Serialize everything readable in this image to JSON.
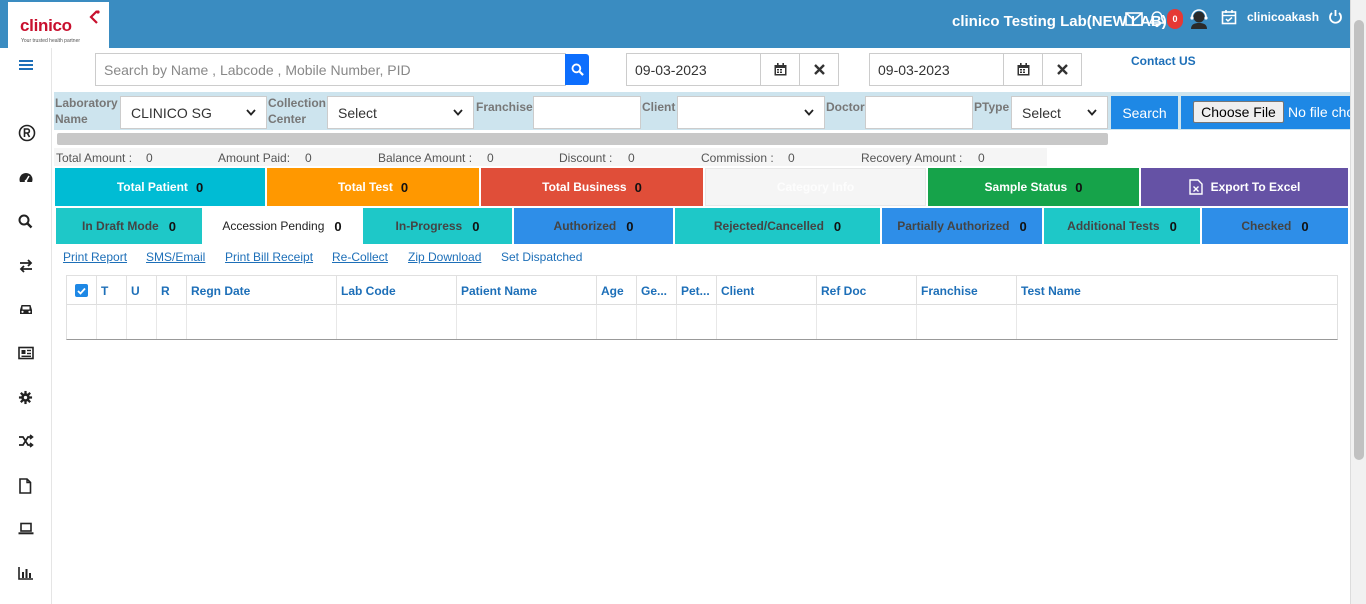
{
  "header": {
    "brand": "clinico",
    "tagline": "Your trusted health partner",
    "lab_title": "clinico Testing Lab(NEW LAB)",
    "notification_count": "0",
    "username": "clinicoakash",
    "background_color": "#3a8cc1"
  },
  "search": {
    "placeholder": "Search by Name , Labcode , Mobile Number, PID",
    "from_date": "09-03-2023",
    "to_date": "09-03-2023",
    "contact_label": "Contact US"
  },
  "filters": {
    "lab_label": "Laboratory Name",
    "lab_value": "CLINICO SG",
    "cc_label": "Collection Center",
    "cc_value": "Select",
    "franchise_label": "Franchise",
    "client_label": "Client",
    "doctor_label": "Doctor",
    "ptype_label": "PType",
    "ptype_value": "Select",
    "search_button": "Search",
    "choose_file_button": "Choose File",
    "file_status": "No file chosen"
  },
  "amounts": {
    "total_amount_label": "Total Amount :",
    "total_amount": "0",
    "amount_paid_label": "Amount Paid:",
    "amount_paid": "0",
    "balance_label": "Balance Amount :",
    "balance": "0",
    "discount_label": "Discount :",
    "discount": "0",
    "commission_label": "Commission :",
    "commission": "0",
    "recovery_label": "Recovery Amount :",
    "recovery": "0"
  },
  "summary_tiles": [
    {
      "label": "Total Patient",
      "count": "0",
      "color": "#00bcd4"
    },
    {
      "label": "Total Test",
      "count": "0",
      "color": "#ff9800"
    },
    {
      "label": "Total Business",
      "count": "0",
      "color": "#e04e39"
    },
    {
      "label": "Category Info",
      "count": "",
      "color": "#f5f5f5"
    },
    {
      "label": "Sample Status",
      "count": "0",
      "color": "#16a34a"
    },
    {
      "label": "Export To Excel",
      "count": "",
      "color": "#6552a5"
    }
  ],
  "status_tiles": [
    {
      "label": "In Draft Mode",
      "count": "0",
      "color": "#1ec8c8"
    },
    {
      "label": "Accession Pending",
      "count": "0",
      "color": "#ffffff"
    },
    {
      "label": "In-Progress",
      "count": "0",
      "color": "#1ec8c8"
    },
    {
      "label": "Authorized",
      "count": "0",
      "color": "#2e8ee8"
    },
    {
      "label": "Rejected/Cancelled",
      "count": "0",
      "color": "#1ec8c8"
    },
    {
      "label": "Partially Authorized",
      "count": "0",
      "color": "#2e8ee8"
    },
    {
      "label": "Additional Tests",
      "count": "0",
      "color": "#1ec8c8"
    },
    {
      "label": "Checked",
      "count": "0",
      "color": "#2e8ee8"
    }
  ],
  "actions": [
    "Print Report",
    "SMS/Email",
    "Print Bill Receipt",
    "Re-Collect",
    "Zip Download",
    "Set Dispatched"
  ],
  "table": {
    "columns": [
      "T",
      "U",
      "R",
      "Regn Date",
      "Lab Code",
      "Patient Name",
      "Age",
      "Ge...",
      "Pet...",
      "Client",
      "Ref Doc",
      "Franchise",
      "Test Name"
    ]
  }
}
